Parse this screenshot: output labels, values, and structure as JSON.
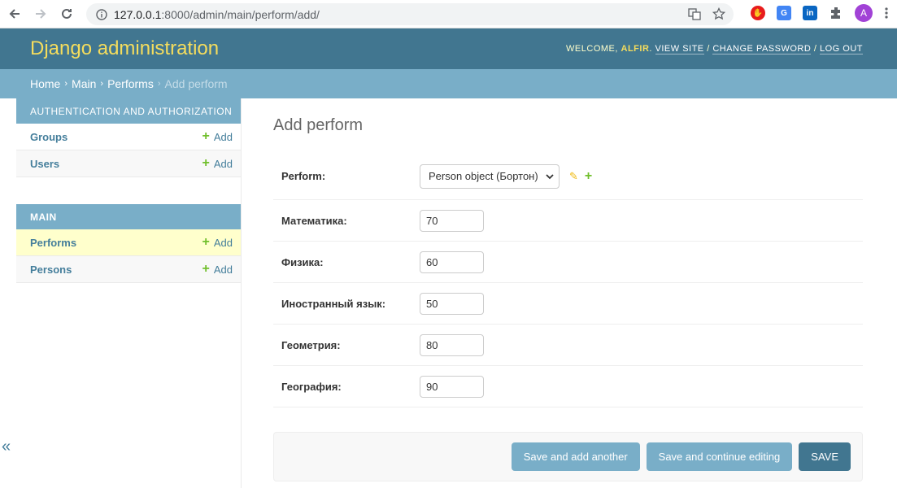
{
  "browser": {
    "url_host": "127.0.0.1",
    "url_path": ":8000/admin/main/perform/add/",
    "avatar_letter": "A"
  },
  "header": {
    "brand": "Django administration",
    "welcome": "WELCOME,",
    "username": "ALFIR",
    "view_site": "VIEW SITE",
    "change_password": "CHANGE PASSWORD",
    "log_out": "LOG OUT"
  },
  "breadcrumbs": {
    "home": "Home",
    "app": "Main",
    "model": "Performs",
    "current": "Add perform"
  },
  "sidebar": {
    "modules": [
      {
        "caption": "AUTHENTICATION AND AUTHORIZATION",
        "rows": [
          {
            "name": "Groups",
            "add": "Add"
          },
          {
            "name": "Users",
            "add": "Add"
          }
        ]
      },
      {
        "caption": "MAIN",
        "rows": [
          {
            "name": "Performs",
            "add": "Add"
          },
          {
            "name": "Persons",
            "add": "Add"
          }
        ]
      }
    ],
    "collapse": "«"
  },
  "form": {
    "title": "Add perform",
    "perform_label": "Perform:",
    "perform_value": "Person object (Бортон)",
    "fields": [
      {
        "label": "Математика:",
        "value": "70"
      },
      {
        "label": "Физика:",
        "value": "60"
      },
      {
        "label": "Иностранный язык:",
        "value": "50"
      },
      {
        "label": "Геометрия:",
        "value": "80"
      },
      {
        "label": "География:",
        "value": "90"
      }
    ]
  },
  "buttons": {
    "save_add_another": "Save and add another",
    "save_continue": "Save and continue editing",
    "save": "SAVE"
  },
  "colors": {
    "header": "#417690",
    "breadcrumbs": "#79aec8",
    "brand": "#f5dd5d",
    "add_green": "#70bf2b"
  }
}
